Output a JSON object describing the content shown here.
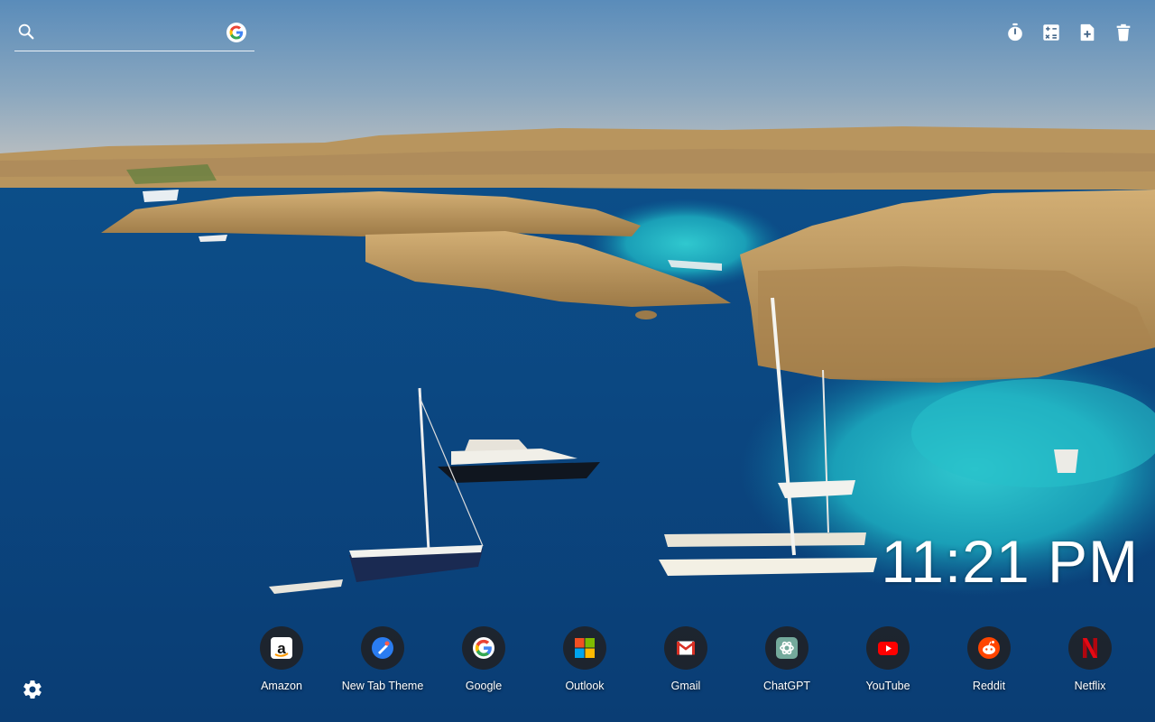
{
  "search": {
    "value": "",
    "placeholder": ""
  },
  "toolbar": {
    "icons": [
      "timer-icon",
      "calculator-icon",
      "add-note-icon",
      "trash-icon"
    ]
  },
  "clock": {
    "time": "11:21 PM"
  },
  "shortcuts": [
    {
      "label": "Amazon",
      "icon": "amazon-icon"
    },
    {
      "label": "New Tab Theme",
      "icon": "new-tab-theme-icon"
    },
    {
      "label": "Google",
      "icon": "google-icon"
    },
    {
      "label": "Outlook",
      "icon": "outlook-icon"
    },
    {
      "label": "Gmail",
      "icon": "gmail-icon"
    },
    {
      "label": "ChatGPT",
      "icon": "chatgpt-icon"
    },
    {
      "label": "YouTube",
      "icon": "youtube-icon"
    },
    {
      "label": "Reddit",
      "icon": "reddit-icon"
    },
    {
      "label": "Netflix",
      "icon": "netflix-icon"
    }
  ],
  "settings": {
    "icon": "gear-icon"
  },
  "colors": {
    "sky": "#5e8fb8",
    "sea_deep": "#0a3f78",
    "lagoon": "#1cb4c4",
    "rock": "#c8a36a"
  }
}
